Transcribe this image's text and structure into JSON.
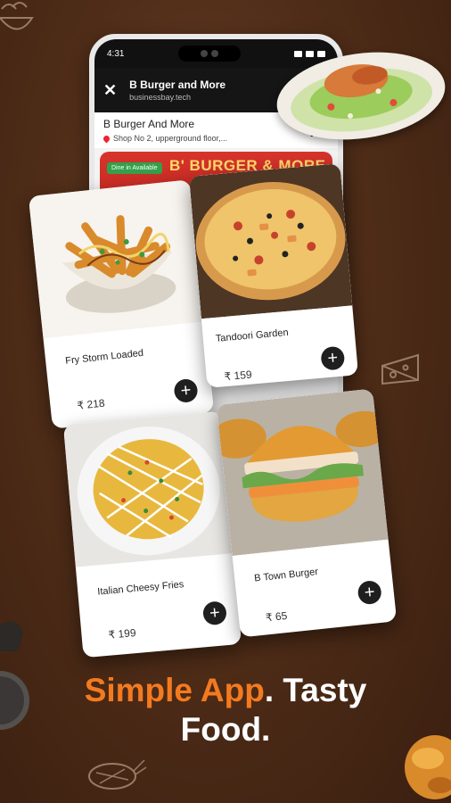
{
  "status_bar": {
    "time": "4:31"
  },
  "app_bar": {
    "title": "B Burger and More",
    "subtitle": "businessbay.tech"
  },
  "store": {
    "name": "B Burger And More",
    "address": "Shop No 2, upperground floor,..."
  },
  "banner": {
    "title": "B' BURGER & MORE",
    "badge": "Dine in Available"
  },
  "cards": [
    {
      "name": "Fry Storm Loaded",
      "price": "₹ 218"
    },
    {
      "name": "Tandoori Garden",
      "price": "₹ 159"
    },
    {
      "name": "Italian Cheesy Fries",
      "price": "₹ 199"
    },
    {
      "name": "B Town Burger",
      "price": "₹ 65"
    }
  ],
  "add_label": "+",
  "tagline": {
    "accent": "Simple App",
    "rest1": ". Tasty",
    "line2": "Food."
  },
  "colors": {
    "accent": "#f47a1f",
    "background": "#4f2d18",
    "badge": "#33a04a"
  }
}
